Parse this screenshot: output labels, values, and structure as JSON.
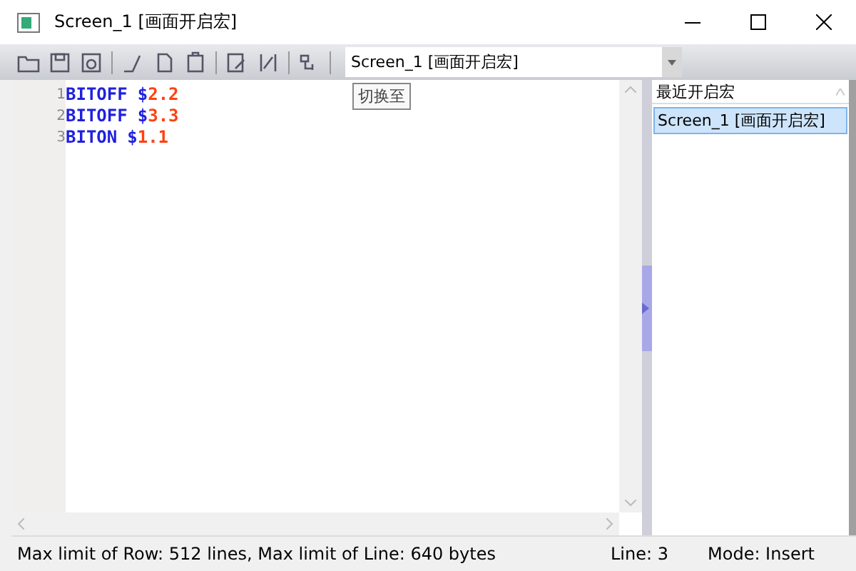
{
  "window": {
    "title": "Screen_1 [画面开启宏]"
  },
  "toolbar": {
    "combo": {
      "value": "Screen_1 [画面开启宏]"
    },
    "tooltip": "切换至"
  },
  "editor": {
    "lines": [
      {
        "number": "1",
        "keyword": "BITOFF",
        "sigil": "$",
        "arg": "2.2"
      },
      {
        "number": "2",
        "keyword": "BITOFF",
        "sigil": "$",
        "arg": "3.3"
      },
      {
        "number": "3",
        "keyword": "BITON",
        "sigil": "$",
        "arg": "1.1"
      }
    ]
  },
  "recent_panel": {
    "header": "最近开启宏",
    "items": [
      {
        "label": "Screen_1 [画面开启宏]",
        "selected": true
      }
    ]
  },
  "status_bar": {
    "limits": "Max limit of Row: 512 lines, Max limit of Line: 640 bytes",
    "line": "Line: 3",
    "mode": "Mode: Insert"
  }
}
